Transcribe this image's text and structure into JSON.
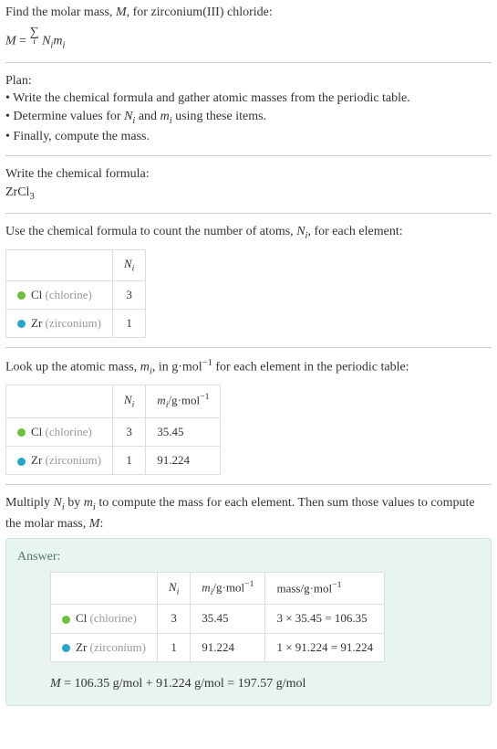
{
  "intro": {
    "line1_a": "Find the molar mass, ",
    "line1_b": ", for zirconium(III) chloride:",
    "M": "M",
    "eq": " = ",
    "sigma": "∑",
    "sigma_sub": "i",
    "Ni": "N",
    "Ni_sub": "i",
    "mi": "m",
    "mi_sub": "i"
  },
  "plan": {
    "title": "Plan:",
    "b1_a": "• Write the chemical formula and gather atomic masses from the periodic table.",
    "b2_a": "• Determine values for ",
    "b2_b": " and ",
    "b2_c": " using these items.",
    "b3": "• Finally, compute the mass."
  },
  "formula": {
    "title": "Write the chemical formula:",
    "zr": "ZrCl",
    "sub": "3"
  },
  "count": {
    "title_a": "Use the chemical formula to count the number of atoms, ",
    "title_b": ", for each element:",
    "h_ni": "N",
    "h_ni_sub": "i",
    "cl_label": "Cl ",
    "cl_paren": "(chlorine)",
    "cl_n": "3",
    "zr_label": "Zr ",
    "zr_paren": "(zirconium)",
    "zr_n": "1"
  },
  "lookup": {
    "title_a": "Look up the atomic mass, ",
    "title_b": ", in g·mol",
    "title_c": " for each element in the periodic table:",
    "neg1": "−1",
    "h_ni": "N",
    "h_ni_sub": "i",
    "h_mi": "m",
    "h_mi_sub": "i",
    "h_mi_unit": "/g·mol",
    "cl_label": "Cl ",
    "cl_paren": "(chlorine)",
    "cl_n": "3",
    "cl_m": "35.45",
    "zr_label": "Zr ",
    "zr_paren": "(zirconium)",
    "zr_n": "1",
    "zr_m": "91.224"
  },
  "multiply": {
    "title_a": "Multiply ",
    "title_b": " by ",
    "title_c": " to compute the mass for each element. Then sum those values to compute the molar mass, ",
    "title_d": ":",
    "M": "M"
  },
  "answer": {
    "title": "Answer:",
    "h_ni": "N",
    "h_ni_sub": "i",
    "h_mi": "m",
    "h_mi_sub": "i",
    "h_mi_unit": "/g·mol",
    "neg1": "−1",
    "h_mass": "mass/g·mol",
    "cl_label": "Cl ",
    "cl_paren": "(chlorine)",
    "cl_n": "3",
    "cl_m": "35.45",
    "cl_mass": "3 × 35.45 = 106.35",
    "zr_label": "Zr ",
    "zr_paren": "(zirconium)",
    "zr_n": "1",
    "zr_m": "91.224",
    "zr_mass": "1 × 91.224 = 91.224",
    "final_M": "M",
    "final_eq": " = 106.35 g/mol + 91.224 g/mol = 197.57 g/mol"
  }
}
